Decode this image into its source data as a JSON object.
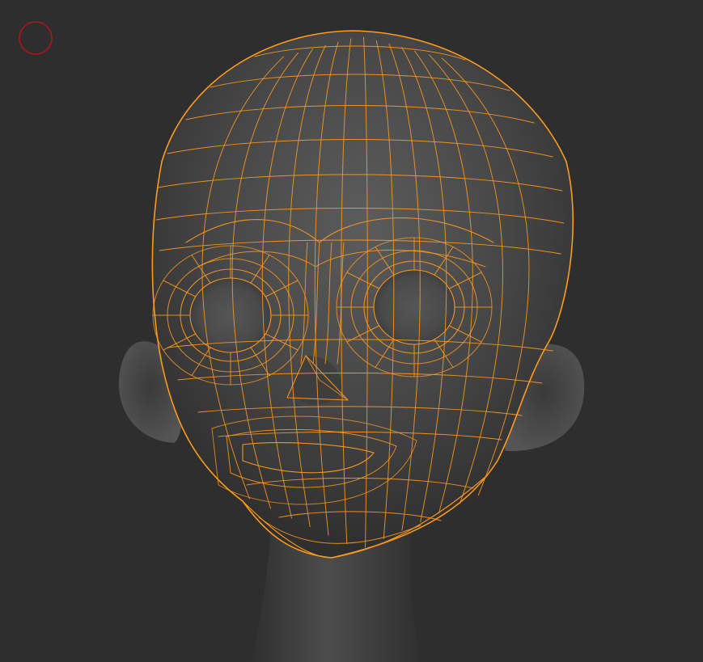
{
  "viewport": {
    "background_color": "#2e2e2e",
    "mesh_surface_color": "#4a4a4a",
    "wireframe_color": "#ff9a1f",
    "brush_cursor_color": "#b0141a"
  }
}
